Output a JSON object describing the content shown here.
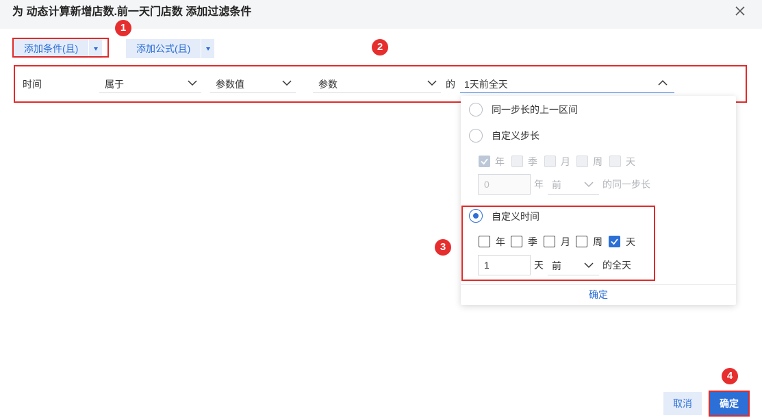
{
  "dialog": {
    "title": "为 动态计算新增店数.前一天门店数 添加过滤条件"
  },
  "toolbar": {
    "add_condition": "添加条件(且)",
    "add_formula": "添加公式(且)"
  },
  "badges": [
    "1",
    "2",
    "3",
    "4"
  ],
  "filter_row": {
    "field": "时间",
    "operator": "属于",
    "value_type": "参数值",
    "param": "参数",
    "connector": "的",
    "value": "1天前全天"
  },
  "dropdown": {
    "option_prev_interval": "同一步长的上一区间",
    "option_custom_step": "自定义步长",
    "custom_step": {
      "units": [
        "年",
        "季",
        "月",
        "周",
        "天"
      ],
      "checked": [
        true,
        false,
        false,
        false,
        false
      ],
      "input_value": "0",
      "unit_label": "年",
      "direction": "前",
      "suffix": "的同一步长"
    },
    "option_custom_time": "自定义时间",
    "selected": "custom_time",
    "custom_time": {
      "units": [
        "年",
        "季",
        "月",
        "周",
        "天"
      ],
      "checked": [
        false,
        false,
        false,
        false,
        true
      ],
      "input_value": "1",
      "unit_label": "天",
      "direction": "前",
      "suffix": "的全天"
    },
    "confirm": "确定"
  },
  "footer": {
    "cancel": "取消",
    "confirm": "确定"
  },
  "colors": {
    "accent": "#2c6fd6",
    "highlight": "#e02a2a",
    "badge": "#e62e2e"
  }
}
